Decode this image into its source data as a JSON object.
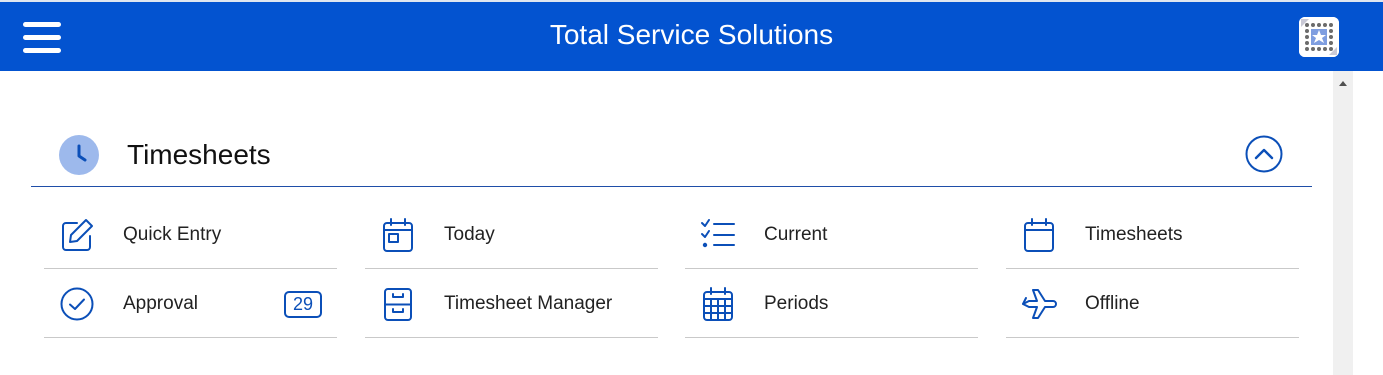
{
  "header": {
    "title": "Total Service Solutions",
    "menu_icon": "hamburger-icon",
    "logo_icon": "app-logo-icon",
    "background": "#0353D0"
  },
  "section": {
    "title": "Timesheets",
    "icon": "clock-icon",
    "collapse_icon": "chevron-up-icon",
    "accent": "#1f4ea8"
  },
  "tiles": [
    {
      "label": "Quick Entry",
      "icon": "edit-icon"
    },
    {
      "label": "Today",
      "icon": "calendar-day-icon"
    },
    {
      "label": "Current",
      "icon": "checklist-icon"
    },
    {
      "label": "Timesheets",
      "icon": "calendar-icon"
    },
    {
      "label": "Approval",
      "icon": "check-circle-icon",
      "badge": "29"
    },
    {
      "label": "Timesheet Manager",
      "icon": "file-cabinet-icon"
    },
    {
      "label": "Periods",
      "icon": "calendar-grid-icon"
    },
    {
      "label": "Offline",
      "icon": "airplane-icon"
    }
  ]
}
